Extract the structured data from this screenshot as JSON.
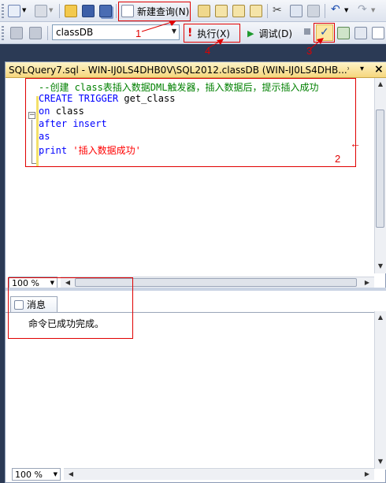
{
  "toolbar": {
    "new_query_label": "新建查询(N)",
    "database": "classDB",
    "execute_label": "执行(X)",
    "debug_label": "调试(D)",
    "parse_check": "✓"
  },
  "tab": {
    "title": "SQLQuery7.sql - WIN-IJ0LS4DHB0V\\SQL2012.classDB (WIN-IJ0LS4DHB...*",
    "pin": "▾",
    "close": "×"
  },
  "editor": {
    "lines": [
      "--创建 class表插入数据DML触发器，插入数据后，提示插入成功",
      "CREATE TRIGGER get_class",
      "on class",
      "after insert",
      "as",
      "print '插入数据成功'"
    ],
    "line2_kw": "CREATE TRIGGER",
    "line2_name": "get_class",
    "line3_kw": "on",
    "line3_name": "class",
    "line4_kw": "after insert",
    "line5_kw": "as",
    "line6_kw": "print",
    "line6_str": "'插入数据成功'",
    "collapse_glyph": "−"
  },
  "zoom": {
    "editor": "100 %",
    "results": "100 %"
  },
  "results": {
    "tab_label": "消息",
    "message": "命令已成功完成。"
  },
  "annotations": [
    "1",
    "2",
    "3",
    "4"
  ],
  "annotation_arrow": "←",
  "colors": {
    "annotation": "#e00000",
    "keyword": "#0000ff",
    "comment": "#008000",
    "string": "#ff0000",
    "tab_active": "#f6d77d"
  }
}
